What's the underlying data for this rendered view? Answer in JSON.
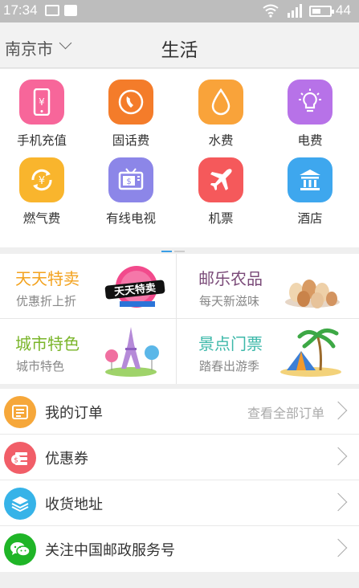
{
  "status_bar": {
    "time": "17:34",
    "battery_text": "44",
    "battery_level_percent": 44,
    "icons": [
      "image-icon",
      "mail-icon",
      "wifi-icon",
      "signal-icon",
      "battery-icon"
    ]
  },
  "header": {
    "city": "南京市",
    "title": "生活"
  },
  "services": [
    {
      "label": "手机充值",
      "icon": "phone-icon",
      "color": "#f7669a"
    },
    {
      "label": "固话费",
      "icon": "telephone-icon",
      "color": "#f47c2a"
    },
    {
      "label": "水费",
      "icon": "water-drop-icon",
      "color": "#f9a33a"
    },
    {
      "label": "电费",
      "icon": "light-bulb-icon",
      "color": "#b772e8"
    },
    {
      "label": "燃气费",
      "icon": "gas-icon",
      "color": "#f9b52d"
    },
    {
      "label": "有线电视",
      "icon": "tv-icon",
      "color": "#8c86e8"
    },
    {
      "label": "机票",
      "icon": "airplane-icon",
      "color": "#f5595b"
    },
    {
      "label": "酒店",
      "icon": "hotel-icon",
      "color": "#3ea7ee"
    }
  ],
  "page_indicator": {
    "current": 1,
    "total": 2
  },
  "promos": [
    {
      "title": "天天特卖",
      "subtitle": "优惠折上折",
      "title_color": "#f3a21d",
      "image_text": "天天特卖",
      "image": "sale-badge-image"
    },
    {
      "title": "邮乐农品",
      "subtitle": "每天新滋味",
      "title_color": "#7a4a78",
      "image": "eggs-image"
    },
    {
      "title": "城市特色",
      "subtitle": "城市特色",
      "title_color": "#7ab52a",
      "image": "eiffel-tower-image"
    },
    {
      "title": "景点门票",
      "subtitle": "踏春出游季",
      "title_color": "#3cb8a9",
      "image": "beach-tent-image"
    }
  ],
  "menu": [
    {
      "label": "我的订单",
      "extra": "查看全部订单",
      "icon": "order-list-icon",
      "color": "#f6a73a"
    },
    {
      "label": "优惠券",
      "extra": "",
      "icon": "coupon-icon",
      "color": "#f15e68"
    },
    {
      "label": "收货地址",
      "extra": "",
      "icon": "layers-icon",
      "color": "#36b3e8"
    },
    {
      "label": "关注中国邮政服务号",
      "extra": "",
      "icon": "wechat-icon",
      "color": "#1fb527"
    }
  ]
}
